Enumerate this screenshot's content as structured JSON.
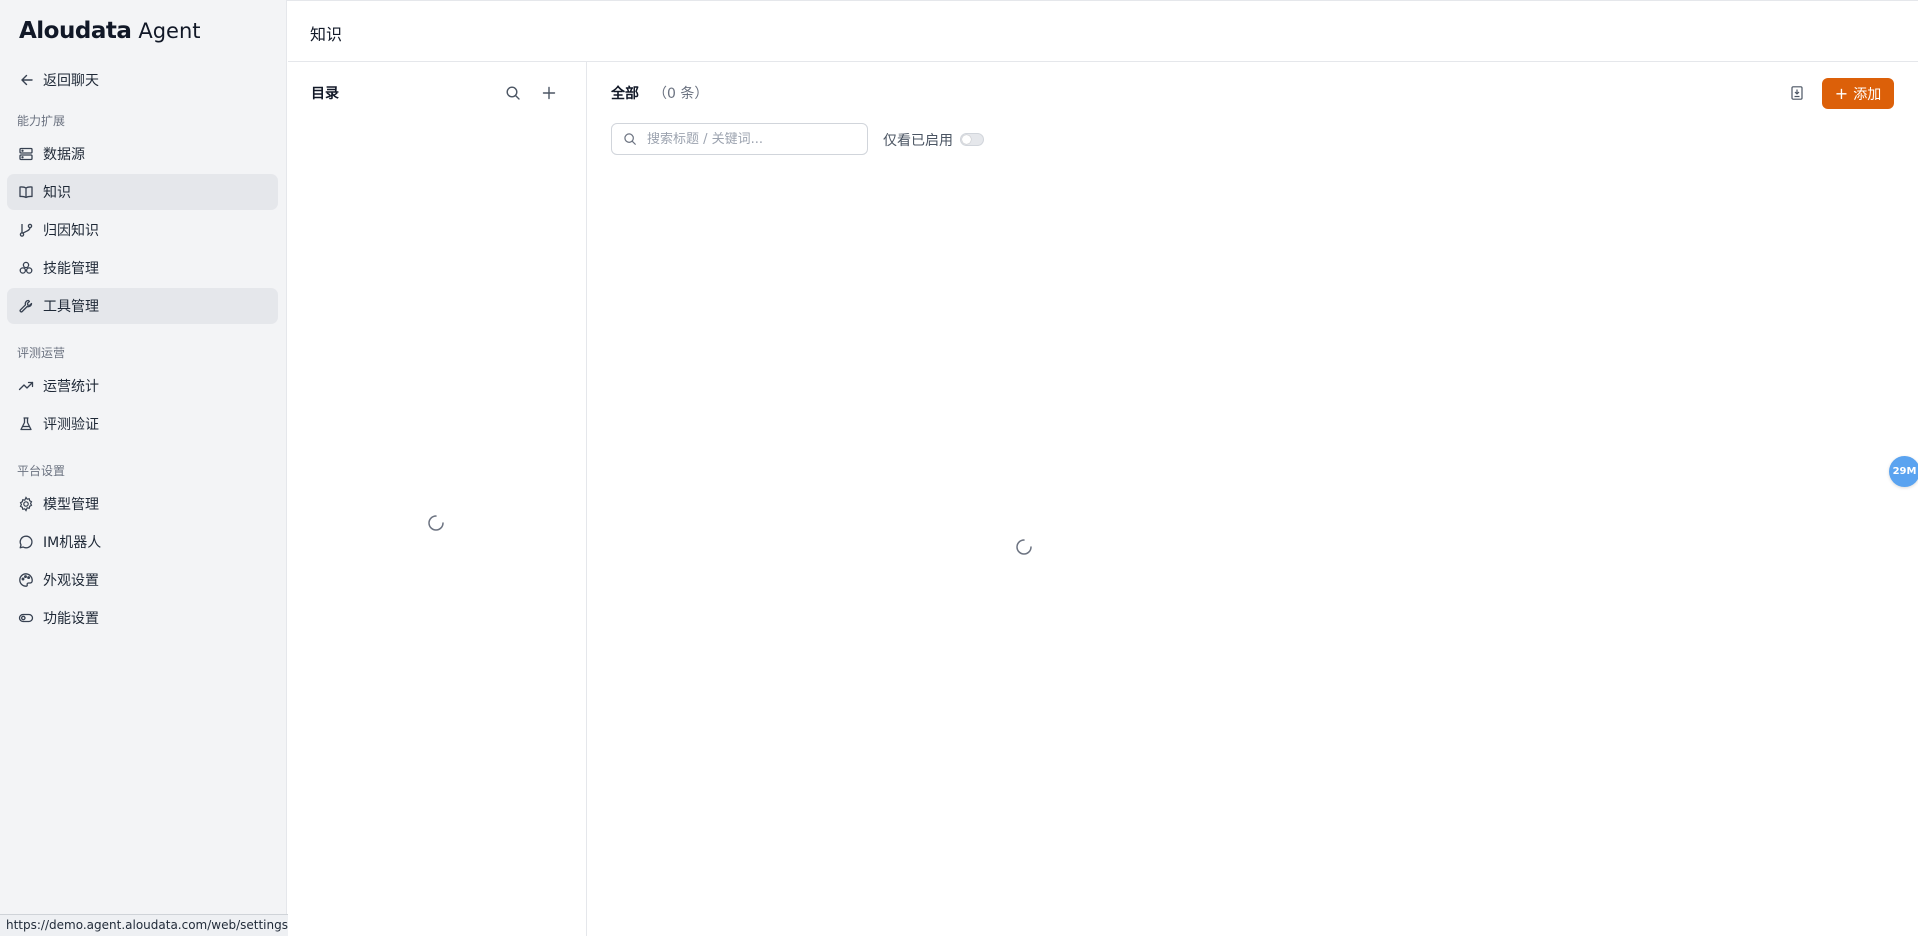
{
  "app": {
    "brand": "Aloudata",
    "product": "Agent"
  },
  "sidebar": {
    "back_label": "返回聊天",
    "sections": [
      {
        "title": "能力扩展"
      },
      {
        "title": "评测运营"
      },
      {
        "title": "平台设置"
      }
    ],
    "items": [
      {
        "label": "数据源",
        "icon": "database-icon",
        "active": false
      },
      {
        "label": "知识",
        "icon": "book-icon",
        "active": true
      },
      {
        "label": "归因知识",
        "icon": "git-branch-icon",
        "active": false
      },
      {
        "label": "技能管理",
        "icon": "skills-icon",
        "active": false
      },
      {
        "label": "工具管理",
        "icon": "wrench-icon",
        "active": true
      },
      {
        "label": "运营统计",
        "icon": "trending-up-icon",
        "active": false
      },
      {
        "label": "评测验证",
        "icon": "flask-icon",
        "active": false
      },
      {
        "label": "模型管理",
        "icon": "gear-icon",
        "active": false
      },
      {
        "label": "IM机器人",
        "icon": "chat-bubble-icon",
        "active": false
      },
      {
        "label": "外观设置",
        "icon": "palette-icon",
        "active": false
      },
      {
        "label": "功能设置",
        "icon": "toggle-icon",
        "active": false
      }
    ]
  },
  "header": {
    "title": "知识"
  },
  "directory": {
    "title": "目录",
    "loading": true
  },
  "main": {
    "title": "全部",
    "count": "（0 条）",
    "add_label": "添加",
    "search_placeholder": "搜索标题 / 关键词...",
    "search_value": "",
    "enabled_only_label": "仅看已启用",
    "enabled_only": false,
    "loading": true
  },
  "floating_badge": "29M",
  "status_url": "https://demo.agent.aloudata.com/web/settings/tools",
  "colors": {
    "accent": "#dc6009",
    "sidebar_bg": "#f3f4f6",
    "active_item_bg": "#e5e7eb",
    "badge_bg": "#5aa3f0"
  }
}
